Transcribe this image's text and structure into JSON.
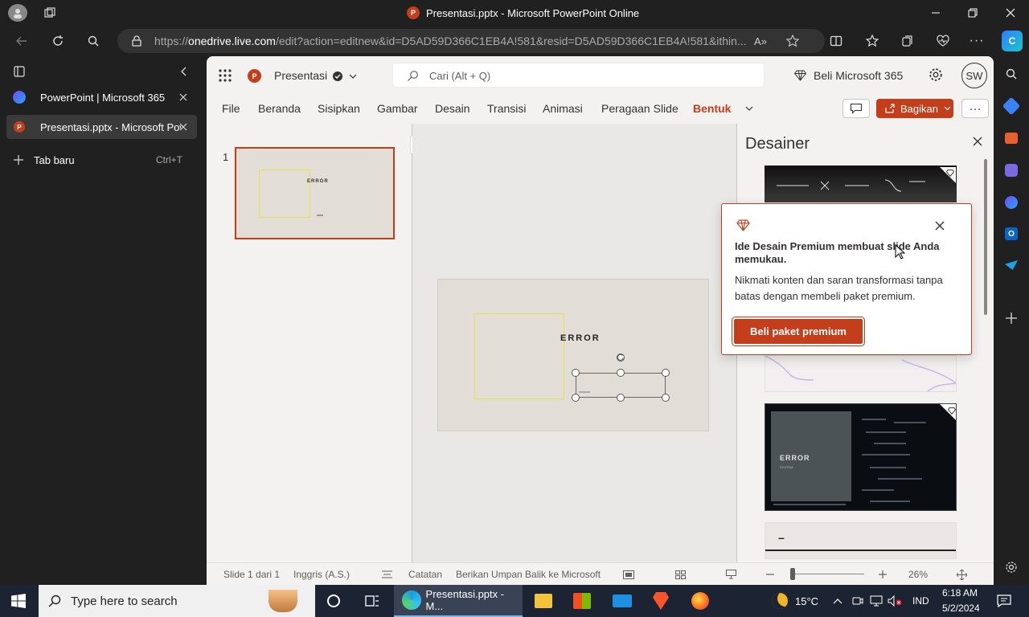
{
  "window": {
    "title": "Presentasi.pptx - Microsoft PowerPoint Online"
  },
  "browser": {
    "url_prefix": "https://",
    "url_domain": "onedrive.live.com",
    "url_rest": "/edit?action=editnew&id=D5AD59D366C1EB4A!581&resid=D5AD59D366C1EB4A!581&ithin..."
  },
  "tabs": {
    "items": [
      {
        "label": "PowerPoint | Microsoft 365"
      },
      {
        "label": "Presentasi.pptx - Microsoft Powe"
      }
    ],
    "new_tab": "Tab baru",
    "new_tab_shortcut": "Ctrl+T"
  },
  "app": {
    "file_name": "Presentasi",
    "search_placeholder": "Cari (Alt + Q)",
    "buy_label": "Beli Microsoft 365",
    "avatar": "SW",
    "share_label": "Bagikan",
    "ribbon_tabs": [
      "File",
      "Beranda",
      "Sisipkan",
      "Gambar",
      "Desain",
      "Transisi",
      "Animasi",
      "Peragaan Slide",
      "Bentuk"
    ]
  },
  "thumbnail": {
    "number": "1",
    "title": "ERROR"
  },
  "slide": {
    "title": "ERROR"
  },
  "designer": {
    "title": "Desainer",
    "popup_title": "Ide Desain Premium membuat slide Anda memukau.",
    "popup_body": "Nikmati konten dan saran transformasi tanpa batas dengan membeli paket premium.",
    "popup_button": "Beli paket premium",
    "design3_title": "ERROR",
    "design3_sub": "SYSTEM",
    "design4_text": "–"
  },
  "status": {
    "slide_counter": "Slide 1 dari 1",
    "language": "Inggris (A.S.)",
    "notes": "Catatan",
    "feedback": "Berikan Umpan Balik ke Microsoft",
    "zoom": "26%"
  },
  "taskbar": {
    "search_placeholder": "Type here to search",
    "active_app": "Presentasi.pptx - M...",
    "temperature": "15°C",
    "lang": "IND",
    "time": "6:18 AM",
    "date": "5/2/2024"
  },
  "colors": {
    "accent": "#c43e1c",
    "highlight_tab": "#c43e1c"
  }
}
